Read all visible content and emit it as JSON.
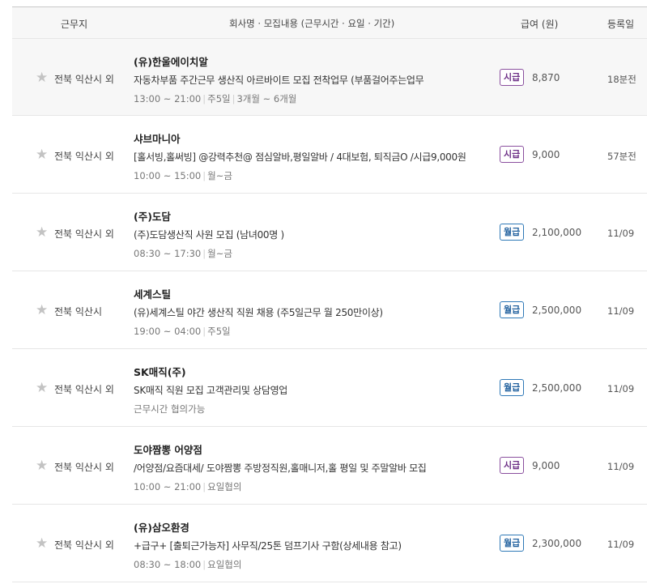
{
  "header": {
    "location": "근무지",
    "company": "회사명 · 모집내용 (근무시간 · 요일 · 기간)",
    "pay": "급여 (원)",
    "date": "등록일"
  },
  "rows": [
    {
      "location": "전북 익산시 외",
      "company": "(유)한울에이치알",
      "description": "자동차부품 주간근무 생산직 아르바이트 모집 전착업무 (부품걸어주는업무",
      "meta": [
        "13:00 ~ 21:00",
        "주5일",
        "3개월 ~ 6개월"
      ],
      "pay_type": "시급",
      "wage": "8,870",
      "date": "18분전"
    },
    {
      "location": "전북 익산시 외",
      "company": "샤브마니아",
      "description": "[홀서빙,홀써빙] @강력추천@ 점심알바,평일알바 / 4대보험, 퇴직금O /시급9,000원",
      "meta": [
        "10:00 ~ 15:00",
        "월~금"
      ],
      "pay_type": "시급",
      "wage": "9,000",
      "date": "57분전"
    },
    {
      "location": "전북 익산시 외",
      "company": "(주)도담",
      "description": "(주)도담생산직 사원 모집 (남녀00명 )",
      "meta": [
        "08:30 ~ 17:30",
        "월~금"
      ],
      "pay_type": "월급",
      "wage": "2,100,000",
      "date": "11/09"
    },
    {
      "location": "전북 익산시",
      "company": "세계스틸",
      "description": "(유)세계스틸 야간 생산직 직원 채용 (주5일근무 월 250만이상)",
      "meta": [
        "19:00 ~ 04:00",
        "주5일"
      ],
      "pay_type": "월급",
      "wage": "2,500,000",
      "date": "11/09"
    },
    {
      "location": "전북 익산시 외",
      "company": "SK매직(주)",
      "description": "SK매직 직원 모집 고객관리및 상담영업",
      "meta": [
        "근무시간 협의가능"
      ],
      "pay_type": "월급",
      "wage": "2,500,000",
      "date": "11/09"
    },
    {
      "location": "전북 익산시 외",
      "company": "도야짬뽕 어양점",
      "description": "/어양점/요즘대세/ 도야짬뽕 주방정직원,홀매니저,홀 평일 및 주말알바 모집",
      "meta": [
        "10:00 ~ 21:00",
        "요일협의"
      ],
      "pay_type": "시급",
      "wage": "9,000",
      "date": "11/09"
    },
    {
      "location": "전북 익산시 외",
      "company": "(유)삼오환경",
      "description": "+급구+ [출퇴근가능자] 사무직/25톤 덤프기사 구함(상세내용 참고)",
      "meta": [
        "08:30 ~ 18:00",
        "요일협의"
      ],
      "pay_type": "월급",
      "wage": "2,300,000",
      "date": "11/09"
    }
  ],
  "colors": {
    "hourly_badge": "#6c2f86",
    "monthly_badge": "#1f5f9d",
    "alt_row_bg": "#f7f7f7"
  }
}
